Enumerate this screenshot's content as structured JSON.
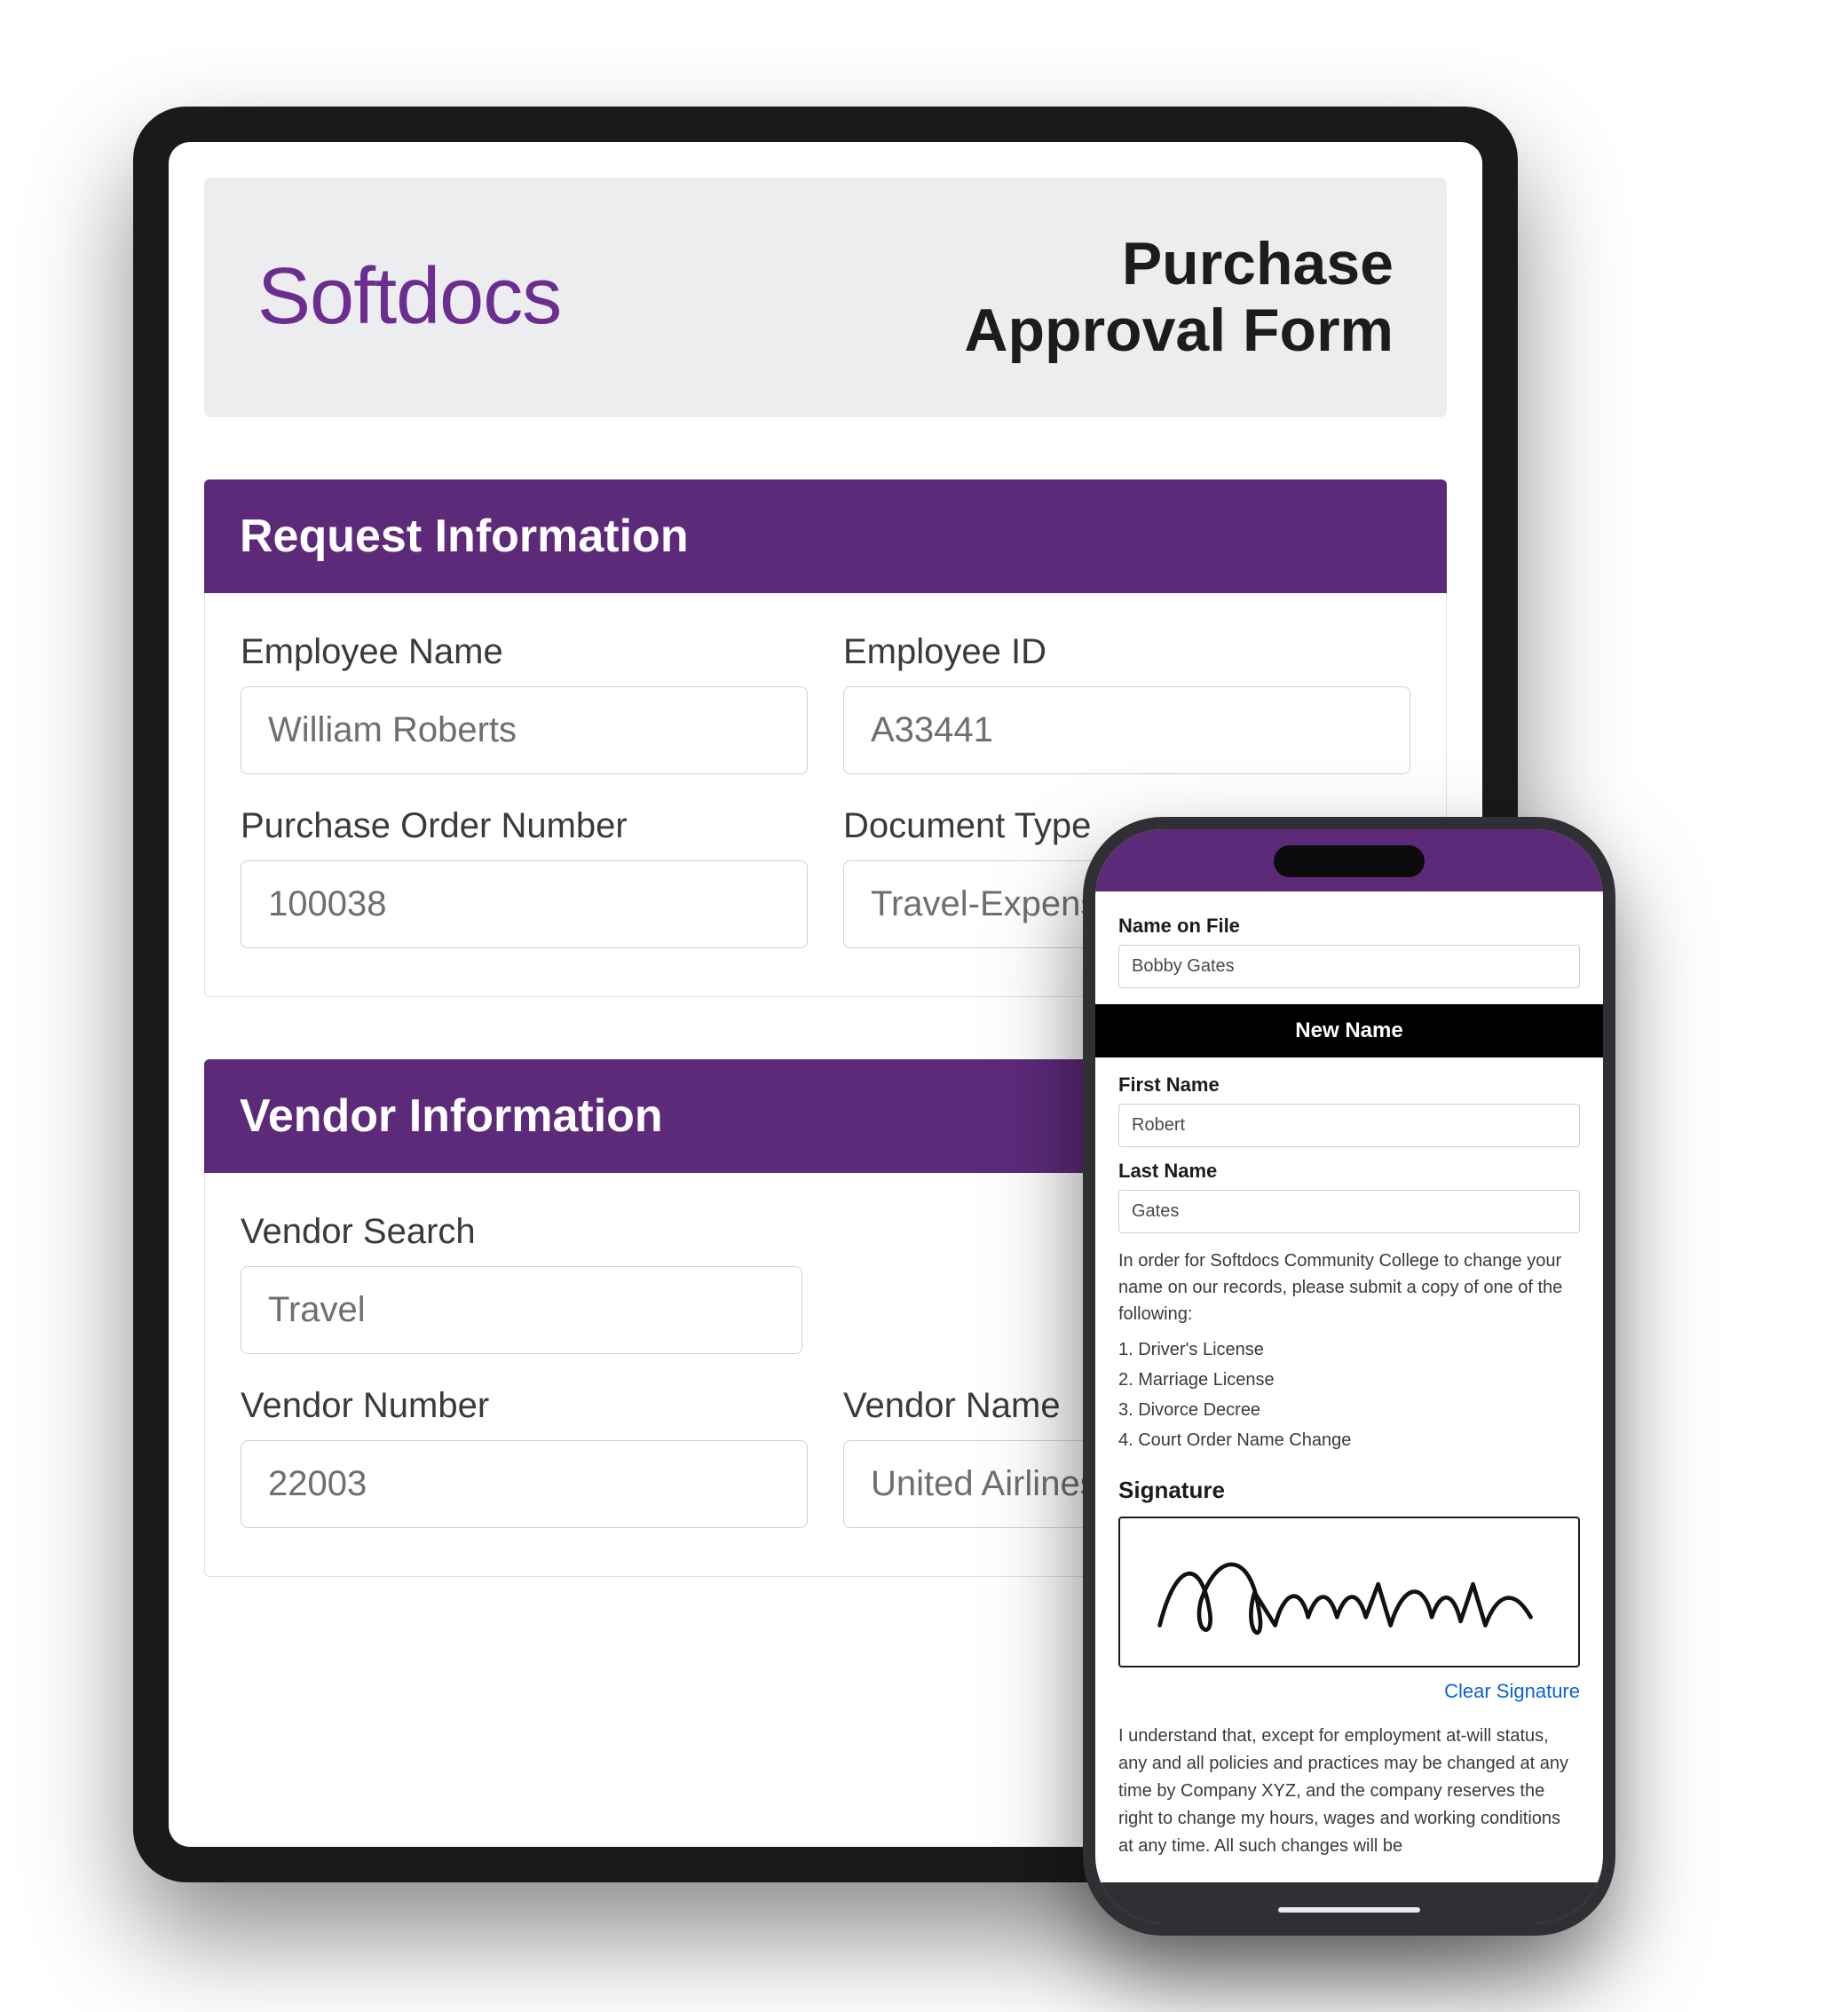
{
  "brand": "Softdocs",
  "form_title_line1": "Purchase",
  "form_title_line2": "Approval Form",
  "sections": {
    "request": {
      "heading": "Request Information",
      "employee_name_label": "Employee Name",
      "employee_name_value": "William Roberts",
      "employee_id_label": "Employee ID",
      "employee_id_value": "A33441",
      "po_number_label": "Purchase Order Number",
      "po_number_value": "100038",
      "doc_type_label": "Document Type",
      "doc_type_value": "Travel-Expense"
    },
    "vendor": {
      "heading": "Vendor Information",
      "vendor_search_label": "Vendor Search",
      "vendor_search_value": "Travel",
      "vendor_number_label": "Vendor Number",
      "vendor_number_value": "22003",
      "vendor_name_label": "Vendor Name",
      "vendor_name_value": "United Airlines"
    }
  },
  "phone": {
    "name_on_file_label": "Name on File",
    "name_on_file_value": "Bobby Gates",
    "new_name_banner": "New Name",
    "first_name_label": "First Name",
    "first_name_value": "Robert",
    "last_name_label": "Last Name",
    "last_name_value": "Gates",
    "instruction_text": "In order for Softdocs Community College to change your name on our records, please submit a copy of one of the following:",
    "docs": [
      "1. Driver's License",
      "2. Marriage License",
      "3. Divorce Decree",
      "4. Court Order Name Change"
    ],
    "signature_label": "Signature",
    "signature_name": "Robert M Gates",
    "clear_signature": "Clear Signature",
    "disclaimer": "I understand that, except for employment at-will status, any and all policies and practices may be changed at any time by Company XYZ, and the company reserves the right to change my hours, wages and working conditions at any time. All such changes will be"
  }
}
